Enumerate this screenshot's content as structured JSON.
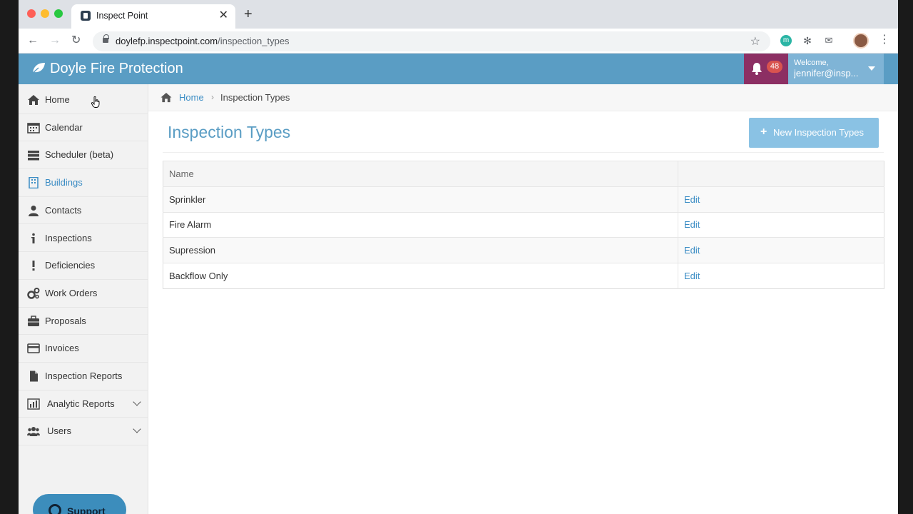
{
  "browser": {
    "tab_title": "Inspect Point",
    "tab_close": "✕",
    "new_tab": "+",
    "url_host": "doylefp.inspectpoint.com",
    "url_path": "/inspection_types",
    "ext_m_label": "m"
  },
  "header": {
    "brand": "Doyle Fire Protection",
    "notification_count": "48",
    "welcome": "Welcome,",
    "user": "jennifer@insp..."
  },
  "sidebar": {
    "items": [
      {
        "label": "Home",
        "icon": "home-icon"
      },
      {
        "label": "Calendar",
        "icon": "calendar-icon"
      },
      {
        "label": "Scheduler (beta)",
        "icon": "server-icon"
      },
      {
        "label": "Buildings",
        "icon": "building-icon",
        "active": true
      },
      {
        "label": "Contacts",
        "icon": "user-icon"
      },
      {
        "label": "Inspections",
        "icon": "info-icon"
      },
      {
        "label": "Deficiencies",
        "icon": "exclamation-icon"
      },
      {
        "label": "Work Orders",
        "icon": "gears-icon"
      },
      {
        "label": "Proposals",
        "icon": "briefcase-icon"
      },
      {
        "label": "Invoices",
        "icon": "credit-card-icon"
      },
      {
        "label": "Inspection Reports",
        "icon": "file-icon"
      },
      {
        "label": "Analytic Reports",
        "icon": "bar-chart-icon",
        "expandable": true
      },
      {
        "label": "Users",
        "icon": "users-icon",
        "expandable": true
      }
    ],
    "support_label": "Support"
  },
  "breadcrumb": {
    "home": "Home",
    "separator": "›",
    "current": "Inspection Types"
  },
  "main": {
    "title": "Inspection Types",
    "new_button_icon": "+",
    "new_button_label": "New Inspection Types",
    "table": {
      "columns": [
        "Name",
        ""
      ],
      "rows": [
        {
          "name": "Sprinkler",
          "action": "Edit"
        },
        {
          "name": "Fire Alarm",
          "action": "Edit"
        },
        {
          "name": "Supression",
          "action": "Edit"
        },
        {
          "name": "Backflow Only",
          "action": "Edit"
        }
      ]
    }
  },
  "colors": {
    "header_blue": "#5a9dc4",
    "notification_bg": "#8c2f63",
    "link_blue": "#3a8cc4",
    "button_light_blue": "#8ac2e4"
  }
}
